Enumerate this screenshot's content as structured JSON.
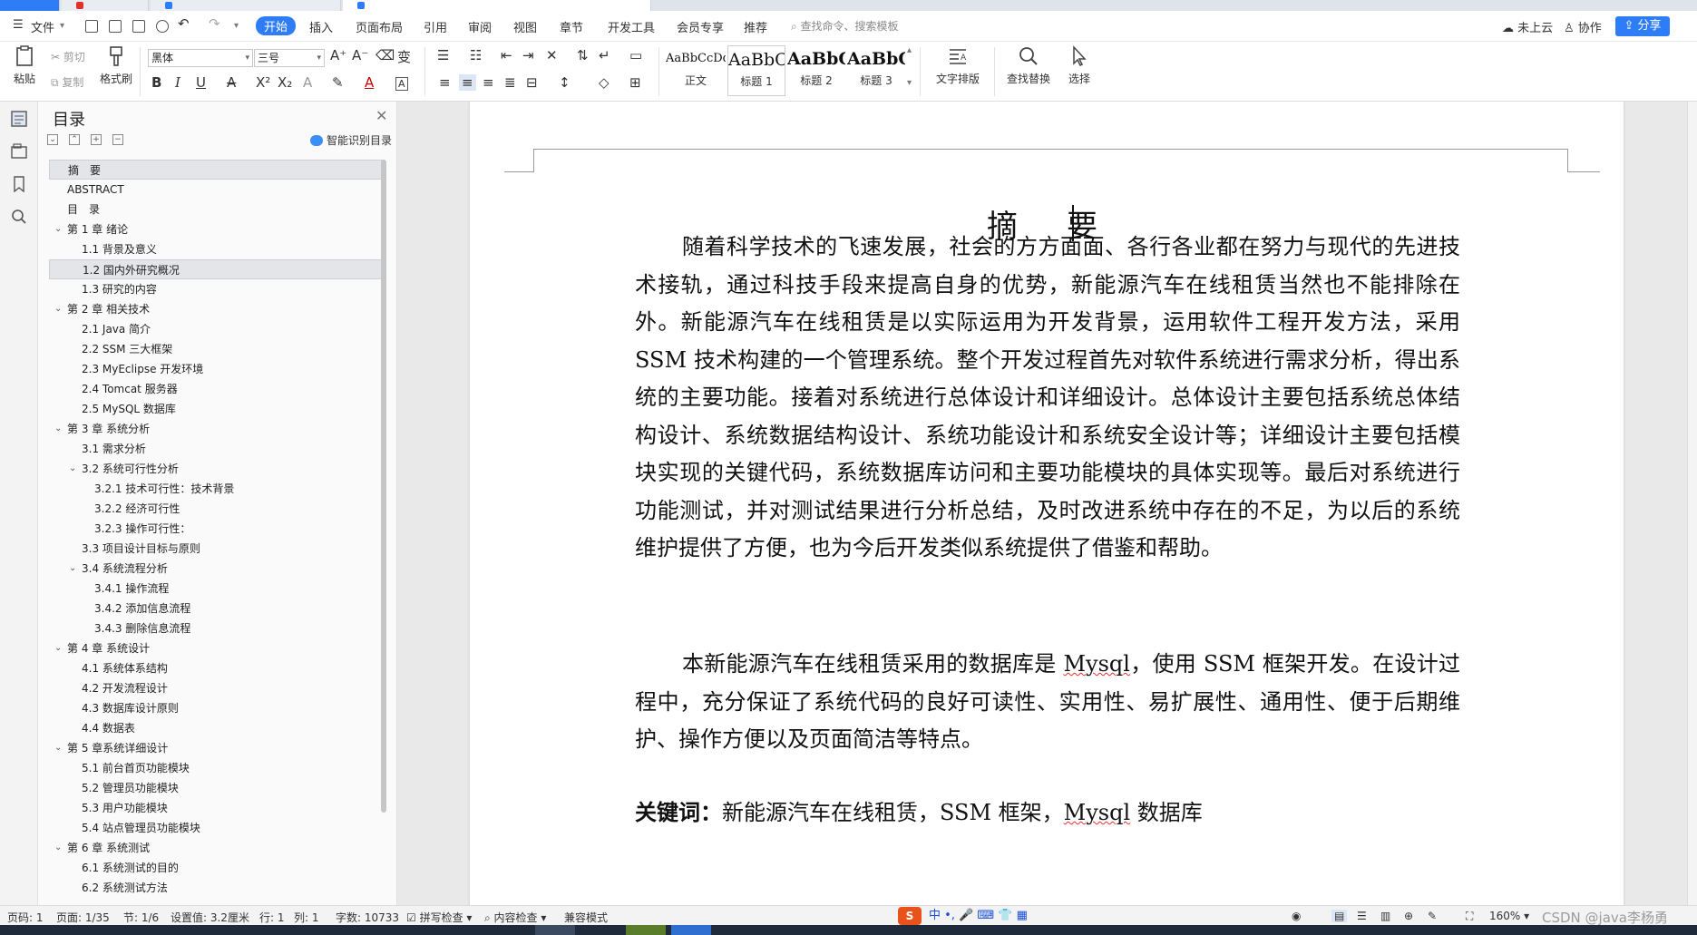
{
  "menubar": {
    "file_label": "文件",
    "tabs": [
      "开始",
      "插入",
      "页面布局",
      "引用",
      "审阅",
      "视图",
      "章节",
      "开发工具",
      "会员专享",
      "推荐"
    ],
    "active_tab": "开始",
    "search_placeholder": "查找命令、搜索模板",
    "cloud_label": "未上云",
    "collab_label": "协作",
    "share_label": "分享"
  },
  "ribbon": {
    "paste_label": "粘贴",
    "cut_label": "剪切",
    "copy_label": "复制",
    "format_painter_label": "格式刷",
    "font_family": "黑体",
    "font_size": "三号",
    "styles": [
      {
        "sample": "AaBbCcDd",
        "name": "正文"
      },
      {
        "sample": "AaBbC",
        "name": "标题 1"
      },
      {
        "sample": "AaBbC",
        "name": "标题 2"
      },
      {
        "sample": "AaBbC",
        "name": "标题 3"
      }
    ],
    "text_layout_label": "文字排版",
    "find_replace_label": "查找替换",
    "select_label": "选择"
  },
  "toc": {
    "title": "目录",
    "smart_label": "智能识别目录",
    "items": [
      {
        "label": "摘　要",
        "level": 1,
        "expand": "",
        "selected": true
      },
      {
        "label": "ABSTRACT",
        "level": 1,
        "expand": ""
      },
      {
        "label": "目　录",
        "level": 1,
        "expand": ""
      },
      {
        "label": "第 1 章  绪论",
        "level": 1,
        "expand": "v"
      },
      {
        "label": "1.1 背景及意义",
        "level": 2,
        "expand": ""
      },
      {
        "label": "1.2  国内外研究概况",
        "level": 2,
        "expand": "",
        "selected": true
      },
      {
        "label": "1.3  研究的内容",
        "level": 2,
        "expand": ""
      },
      {
        "label": "第 2 章  相关技术",
        "level": 1,
        "expand": "v"
      },
      {
        "label": "2.1 Java 简介",
        "level": 2,
        "expand": ""
      },
      {
        "label": "2.2 SSM 三大框架",
        "level": 2,
        "expand": ""
      },
      {
        "label": "2.3 MyEclipse 开发环境",
        "level": 2,
        "expand": ""
      },
      {
        "label": "2.4 Tomcat 服务器",
        "level": 2,
        "expand": ""
      },
      {
        "label": "2.5 MySQL 数据库",
        "level": 2,
        "expand": ""
      },
      {
        "label": "第 3 章  系统分析",
        "level": 1,
        "expand": "v"
      },
      {
        "label": "3.1  需求分析",
        "level": 2,
        "expand": ""
      },
      {
        "label": "3.2  系统可行性分析",
        "level": 2,
        "expand": "v"
      },
      {
        "label": "3.2.1 技术可行性：技术背景",
        "level": 3,
        "expand": ""
      },
      {
        "label": "3.2.2 经济可行性",
        "level": 3,
        "expand": ""
      },
      {
        "label": "3.2.3 操作可行性：",
        "level": 3,
        "expand": ""
      },
      {
        "label": "3.3  项目设计目标与原则",
        "level": 2,
        "expand": ""
      },
      {
        "label": "3.4 系统流程分析",
        "level": 2,
        "expand": "v"
      },
      {
        "label": "3.4.1 操作流程",
        "level": 3,
        "expand": ""
      },
      {
        "label": "3.4.2 添加信息流程",
        "level": 3,
        "expand": ""
      },
      {
        "label": "3.4.3 删除信息流程",
        "level": 3,
        "expand": ""
      },
      {
        "label": "第 4 章  系统设计",
        "level": 1,
        "expand": "v"
      },
      {
        "label": "4.1  系统体系结构",
        "level": 2,
        "expand": ""
      },
      {
        "label": "4.2 开发流程设计",
        "level": 2,
        "expand": ""
      },
      {
        "label": "4.3  数据库设计原则",
        "level": 2,
        "expand": ""
      },
      {
        "label": "4.4  数据表",
        "level": 2,
        "expand": ""
      },
      {
        "label": "第 5 章系统详细设计",
        "level": 1,
        "expand": "v"
      },
      {
        "label": "5.1 前台首页功能模块",
        "level": 2,
        "expand": ""
      },
      {
        "label": "5.2 管理员功能模块",
        "level": 2,
        "expand": ""
      },
      {
        "label": "5.3 用户功能模块",
        "level": 2,
        "expand": ""
      },
      {
        "label": "5.4 站点管理员功能模块",
        "level": 2,
        "expand": ""
      },
      {
        "label": "第 6 章    系统测试",
        "level": 1,
        "expand": "v"
      },
      {
        "label": "6.1 系统测试的目的",
        "level": 2,
        "expand": ""
      },
      {
        "label": "6.2 系统测试方法",
        "level": 2,
        "expand": ""
      }
    ]
  },
  "document": {
    "title": "摘　要",
    "para1": "随着科学技术的飞速发展，社会的方方面面、各行各业都在努力与现代的先进技术接轨，通过科技手段来提高自身的优势，新能源汽车在线租赁当然也不能排除在外。新能源汽车在线租赁是以实际运用为开发背景，运用软件工程开发方法，采用 SSM 技术构建的一个管理系统。整个开发过程首先对软件系统进行需求分析，得出系统的主要功能。接着对系统进行总体设计和详细设计。总体设计主要包括系统总体结构设计、系统数据结构设计、系统功能设计和系统安全设计等；详细设计主要包括模块实现的关键代码，系统数据库访问和主要功能模块的具体实现等。最后对系统进行功能测试，并对测试结果进行分析总结，及时改进系统中存在的不足，为以后的系统维护提供了方便，也为今后开发类似系统提供了借鉴和帮助。",
    "para2_a": "本新能源汽车在线租赁采用的数据库是 ",
    "para2_mysql": "Mysql",
    "para2_b": "，使用 SSM 框架开发。在设计过程中，充分保证了系统代码的良好可读性、实用性、易扩展性、通用性、便于后期维护、操作方便以及页面简洁等特点。",
    "keywords_label": "关键词：",
    "keywords_a": "新能源汽车在线租赁，SSM 框架，",
    "keywords_mysql": "Mysql",
    "keywords_b": " 数据库"
  },
  "statusbar": {
    "page_num": "页码: 1",
    "pages": "页面: 1/35",
    "section": "节: 1/6",
    "setting": "设置值: 3.2厘米",
    "row": "行: 1",
    "col": "列: 1",
    "word_count": "字数: 10733",
    "spell_check": "拼写检查",
    "content_check": "内容检查",
    "compat_mode": "兼容模式",
    "ime_text": "中 •, 🎤 ⌨ 👕 ▦",
    "zoom": "160%",
    "watermark": "CSDN @java李杨勇"
  }
}
